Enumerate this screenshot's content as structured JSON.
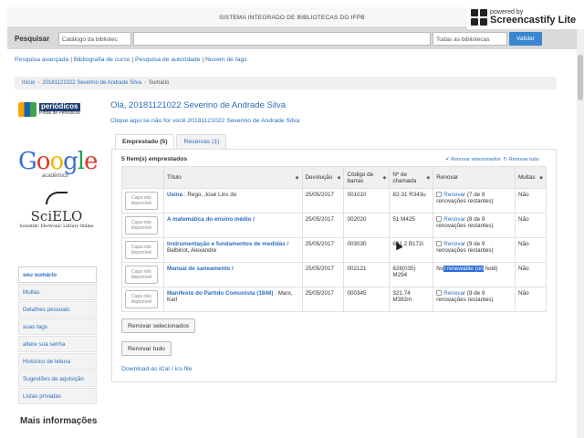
{
  "watermark": {
    "small": "powered by",
    "big": "Screencastify Lite"
  },
  "header": {
    "title": "SISTEMA INTEGRADO DE BIBLIOTECAS DO IFPB"
  },
  "search": {
    "label": "Pesquisar",
    "catalog_select": "Catálogo da bibliotec",
    "library_select": "Todas as bibliotecas",
    "submit": "Validar"
  },
  "links": {
    "items": [
      "Pesquisa avançada",
      "Bibliografia de curso",
      "Pesquisa de autoridade",
      "Nuvem de tags"
    ],
    "sep": " | "
  },
  "breadcrumb": {
    "items": [
      "Início",
      "20181121022 Severino de Andrade Silva",
      "Sumário"
    ],
    "sep": "›"
  },
  "sidebar": {
    "periodicos_top": "periódicos",
    "periodicos_bottom": "Portal de Periódicos",
    "google_sub": "acadêmico",
    "scielo_word": "SciELO",
    "scielo_sub": "Scientific Electronic Library Online",
    "nav": [
      "seu sumário",
      "Multas",
      "Detalhes pessoais",
      "suas tags",
      "altere sua senha",
      "Histórico de leitura",
      "Sugestões de aquisição",
      "Listas privadas"
    ],
    "more_info": "Mais informações"
  },
  "main": {
    "greeting": "Olá, 20181121022 Severino de Andrade Silva",
    "not_you": "Clique aqui se não for você 20181121022 Severino de Andrade Silva",
    "tabs": [
      "Emprestado (5)",
      "Reservas (1)"
    ],
    "count": "5 Item(s) emprestados",
    "renew_selected_link": "Renovar selecionados",
    "renew_all_link": "Renovar tudo",
    "columns": [
      "Título",
      "Devolução",
      "Código de barras",
      "Nº de chamada",
      "Renovar",
      "Multas"
    ],
    "cover_text": "Capa não disponível",
    "rows": [
      {
        "title": "Usina",
        "author": " : Rego, José Lins do",
        "due": "25/05/2017",
        "barcode": "001010",
        "call": "82-31 R343u",
        "renew": "Renovar",
        "renew_note": " (7 de 9 renovações restantes)",
        "fines": "Não"
      },
      {
        "title": "A matemática do ensino médio /",
        "author": "",
        "due": "25/05/2017",
        "barcode": "002020",
        "call": "51 M425",
        "renew": "Renovar",
        "renew_note": " (8 de 9 renovações restantes)",
        "fines": "Não"
      },
      {
        "title": "Instrumentação e fundamentos de medidas",
        "author": " / Balbinot, Alexandre",
        "due": "25/05/2017",
        "barcode": "003030",
        "call": "681.2 B172i",
        "renew": "Renovar",
        "renew_note": " (9 de 9 renovações restantes)",
        "fines": "Não"
      },
      {
        "title": "Manual de saneamento /",
        "author": "",
        "due": "25/05/2017",
        "barcode": "002121",
        "call": "628(035) M294",
        "renew_pre": "No",
        "renew_hl": "t renewable (on",
        "renew_post": " hold)",
        "fines": "Não"
      },
      {
        "title": "Manifesto do Partido Comunista (1848)",
        "author": " : Marx, Karl",
        "due": "25/05/2017",
        "barcode": "000345",
        "call": "321.74 M392m",
        "renew": "Renovar",
        "renew_note": " (9 de 9 renovações restantes)",
        "fines": "Não"
      }
    ],
    "btn_renew_selected": "Renovar selecionados",
    "btn_renew_all": "Renovar tudo",
    "ical": "Download as iCal / ics file"
  }
}
